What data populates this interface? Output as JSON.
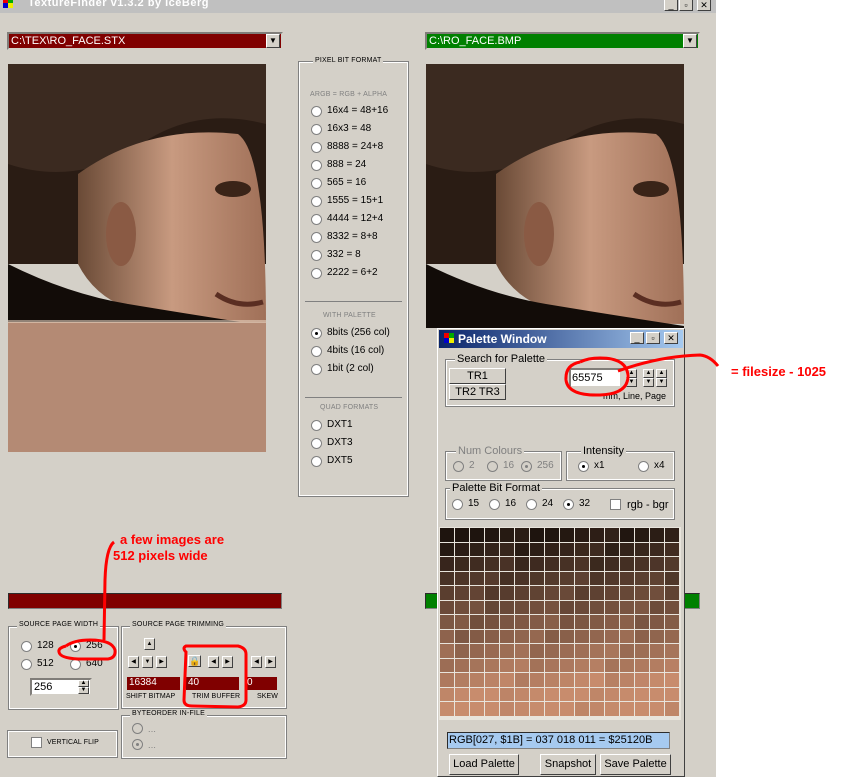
{
  "window": {
    "title": "TextureFinder v1.3.2   by   IceBerg"
  },
  "left_file": {
    "path": "C:\\TEX\\RO_FACE.STX",
    "color": "#800000"
  },
  "right_file": {
    "path": "C:\\RO_FACE.BMP",
    "color": "#008000"
  },
  "pixel_format": {
    "title": "PIXEL BIT FORMAT",
    "subtitle": "ARGB = RGB + ALPHA",
    "options": [
      "16x4 = 48+16",
      "16x3 = 48",
      "8888 = 24+8",
      "888 = 24",
      "565 = 16",
      "1555 = 15+1",
      "4444 = 12+4",
      "8332 = 8+8",
      "332 = 8",
      "2222 = 6+2"
    ],
    "with_palette_title": "WITH PALETTE",
    "palette_options": [
      "8bits (256 col)",
      "4bits (16 col)",
      "1bit (2 col)"
    ],
    "selected_palette": "8bits (256 col)",
    "quad_title": "QUAD FORMATS",
    "quad_options": [
      "DXT1",
      "DXT3",
      "DXT5"
    ]
  },
  "source_page_width": {
    "title": "SOURCE PAGE WIDTH",
    "options": [
      "128",
      "256",
      "512",
      "640"
    ],
    "selected": "256",
    "spin_value": "256"
  },
  "source_page_trimming": {
    "title": "SOURCE PAGE TRIMMING",
    "shift_value": "16384",
    "trim_value": "40",
    "skew_value": "0",
    "shift_label": "SHIFT BITMAP",
    "trim_label": "TRIM BUFFER",
    "skew_label": "SKEW"
  },
  "byteorder": {
    "title": "BYTEORDER IN-FILE",
    "opt1": "...",
    "opt2": "..."
  },
  "vertical_flip": {
    "label": "VERTICAL FLIP"
  },
  "palette_window": {
    "title": "Palette Window",
    "search_title": "Search for Palette",
    "tr1": "TR1",
    "tr23": "TR2 TR3",
    "offset_value": "65575",
    "offset_caption": "mm, Line, Page",
    "num_colours_title": "Num Colours",
    "num_colours_options": [
      "2",
      "16",
      "256"
    ],
    "intensity_title": "Intensity",
    "intensity_options": [
      "x1",
      "x4"
    ],
    "bit_format_title": "Palette Bit Format",
    "bit_format_options": [
      "15",
      "16",
      "24",
      "32"
    ],
    "rgb_bgr_label": "rgb - bgr",
    "status": "RGB[027, $1B] =  037 018 011 = $25120B",
    "load_button": "Load Palette",
    "snapshot_button": "Snapshot",
    "save_button": "Save Palette"
  },
  "annotations": {
    "filesize": "= filesize - 1025",
    "wide_line1": "a few images are",
    "wide_line2": "512 pixels wide"
  }
}
